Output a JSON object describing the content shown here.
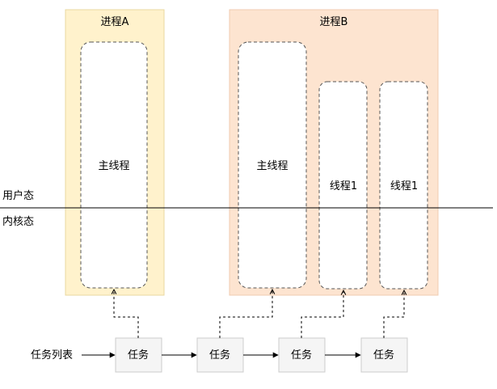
{
  "diagram": {
    "process_a": {
      "label": "进程A",
      "fill": "#fff2cc",
      "stroke": "#e8d8a0"
    },
    "process_b": {
      "label": "进程B",
      "fill": "#fde4d0",
      "stroke": "#f0cbb0"
    },
    "threads": {
      "a_main": "主线程",
      "b_main": "主线程",
      "b_thread1": "线程1",
      "b_thread2": "线程1"
    },
    "layers": {
      "user": "用户态",
      "kernel": "内核态"
    },
    "task_list": {
      "label": "任务列表"
    },
    "tasks": [
      "任务",
      "任务",
      "任务",
      "任务"
    ],
    "colors": {
      "task_fill": "#f5f5f5",
      "task_stroke": "#cccccc",
      "line": "#000000"
    }
  }
}
